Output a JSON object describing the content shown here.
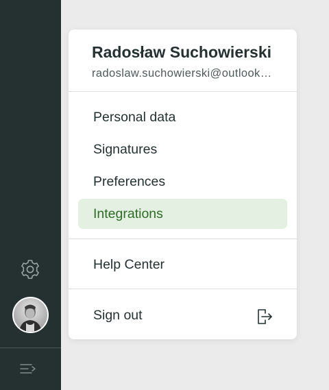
{
  "user": {
    "name": "Radosław Suchowierski",
    "email": "radoslaw.suchowierski@outlook.com"
  },
  "menu": {
    "items": [
      {
        "label": "Personal data",
        "active": false
      },
      {
        "label": "Signatures",
        "active": false
      },
      {
        "label": "Preferences",
        "active": false
      },
      {
        "label": "Integrations",
        "active": true
      }
    ],
    "help_label": "Help Center",
    "signout_label": "Sign out"
  },
  "sidebar": {
    "settings_icon": "gear-icon",
    "avatar": "user-avatar",
    "collapse_icon": "collapse-menu-icon"
  },
  "colors": {
    "sidebar_bg": "#243130",
    "active_bg": "#e3f0e2",
    "active_text": "#2f6b26",
    "text": "#243130"
  }
}
